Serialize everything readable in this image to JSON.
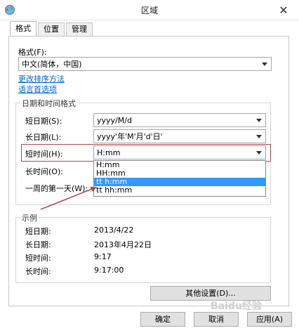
{
  "window": {
    "title": "区域"
  },
  "tabs": [
    {
      "label": "格式"
    },
    {
      "label": "位置"
    },
    {
      "label": "管理"
    }
  ],
  "format": {
    "label": "格式(F):",
    "value": "中文(简体，中国)",
    "link_sort": "更改排序方法",
    "link_language": "语言首选项"
  },
  "datetime_group": {
    "title": "日期和时间格式",
    "short_date": {
      "label": "短日期(S):",
      "value": "yyyy/M/d"
    },
    "long_date": {
      "label": "长日期(L):",
      "value": "yyyy'年'M'月'd'日'"
    },
    "short_time": {
      "label": "短时间(H):",
      "value": "H:mm"
    },
    "long_time": {
      "label": "长时间(O):"
    },
    "first_day": {
      "label": "一周的第一天(W):"
    },
    "dropdown_options": [
      "H:mm",
      "HH:mm",
      "tt h:mm",
      "tt hh:mm"
    ],
    "dropdown_selected_index": 2
  },
  "example_group": {
    "title": "示例",
    "rows": [
      {
        "label": "短日期:",
        "value": "2013/4/22"
      },
      {
        "label": "长日期:",
        "value": "2013年4月22日"
      },
      {
        "label": "短时间:",
        "value": "9:17"
      },
      {
        "label": "长时间:",
        "value": "9:17:00"
      }
    ]
  },
  "buttons": {
    "other_settings": "其他设置(D)...",
    "ok": "确定",
    "cancel": "取消",
    "apply": "应用(A)"
  },
  "watermark": "Baidu经验",
  "colors": {
    "link": "#0066cc",
    "selection": "#3399ff",
    "annotation": "#b04a4a"
  }
}
